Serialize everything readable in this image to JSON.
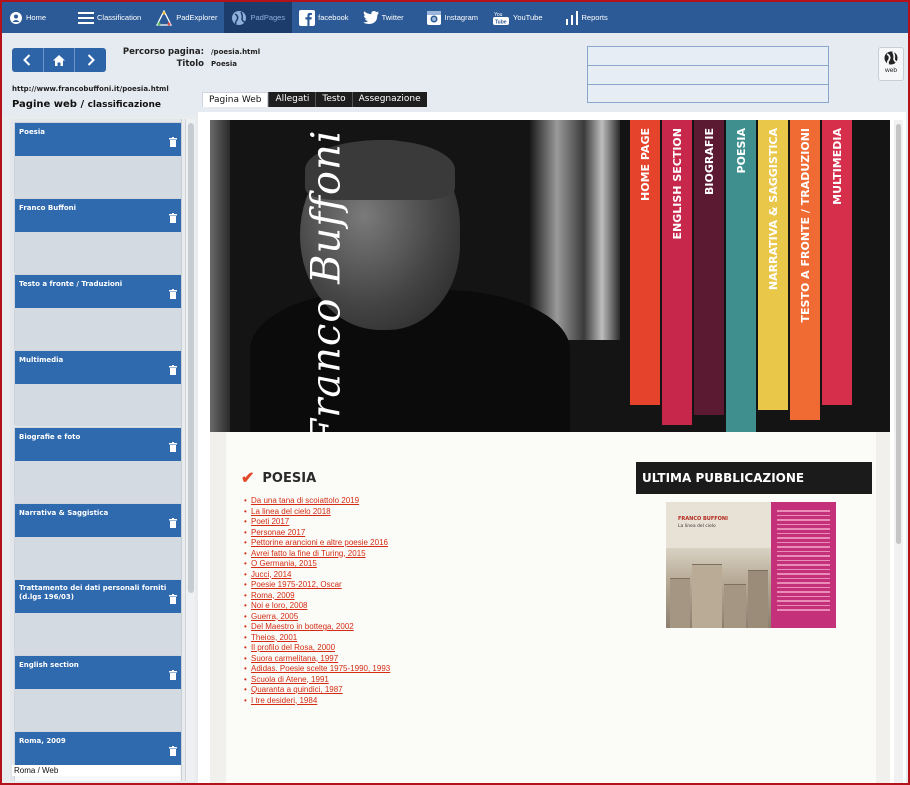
{
  "topbar": {
    "items": [
      {
        "label": "Home",
        "icon": "home-icon"
      },
      {
        "label": "Classification",
        "icon": "list-icon"
      },
      {
        "label": "PadExplorer",
        "icon": "explorer-icon"
      },
      {
        "label": "PadPages",
        "icon": "globe-icon",
        "active": true
      },
      {
        "label": "facebook",
        "icon": "facebook-icon"
      },
      {
        "label": "Twitter",
        "icon": "twitter-icon"
      },
      {
        "label": "Instagram",
        "icon": "instagram-icon"
      },
      {
        "label": "YouTube",
        "icon": "youtube-icon"
      },
      {
        "label": "Reports",
        "icon": "chart-icon"
      }
    ]
  },
  "header": {
    "percorso_label": "Percorso pagina:",
    "percorso_value": "/poesia.html",
    "titolo_label": "Titolo",
    "titolo_value": "Poesia",
    "url": "http://www.francobuffoni.it/poesia.html",
    "web_button": "web"
  },
  "sidebar": {
    "heading": "Pagine web",
    "heading_sep": " / ",
    "heading_sub": "classificazione",
    "cards": [
      "Poesia",
      "Franco Buffoni",
      "Testo a fronte / Traduzioni",
      "Multimedia",
      "Biografie e foto",
      "Narrativa & Saggistica",
      "Trattamento dei dati personali forniti (d.lgs 196/03)",
      "English section",
      "Roma, 2009"
    ],
    "footer": "Roma / Web"
  },
  "tabs": [
    "Pagina Web",
    "Allegati",
    "Testo",
    "Assegnazione"
  ],
  "site": {
    "signature": "Franco Buffoni",
    "menu": [
      {
        "label": "HOME PAGE",
        "color": "#e5432c"
      },
      {
        "label": "ENGLISH SECTION",
        "color": "#c6274a"
      },
      {
        "label": "BIOGRAFIE",
        "color": "#5c1a32"
      },
      {
        "label": "POESIA",
        "color": "#3f8f8e"
      },
      {
        "label": "NARRATIVA & SAGGISTICA",
        "color": "#e9c749"
      },
      {
        "label": "TESTO A FRONTE / TRADUZIONI",
        "color": "#ef6b33"
      },
      {
        "label": "MULTIMEDIA",
        "color": "#d52f4b"
      }
    ],
    "section_title": "POESIA",
    "poems": [
      "Da una tana di scoiattolo 2019",
      "La linea del cielo 2018",
      "Poeti 2017",
      "Personae 2017",
      "Pettorine arancioni e altre poesie 2016",
      "Avrei fatto la fine di Turing, 2015",
      "O Germania, 2015",
      "Jucci, 2014",
      "Poesie 1975-2012, Oscar",
      "Roma, 2009",
      "Noi e loro, 2008",
      "Guerra, 2005",
      "Del Maestro in bottega, 2002",
      "Theios, 2001",
      "Il profilo del Rosa, 2000",
      "Suora carmelitana, 1997",
      "Adidas. Poesie scelte 1975-1990, 1993",
      "Scuola di Atene, 1991",
      "Quaranta a quindici, 1987",
      "I tre desideri, 1984"
    ],
    "ultima_title": "ULTIMA PUBBLICAZIONE",
    "book_author": "FRANCO BUFFONI",
    "book_title": "La linea del cielo"
  }
}
